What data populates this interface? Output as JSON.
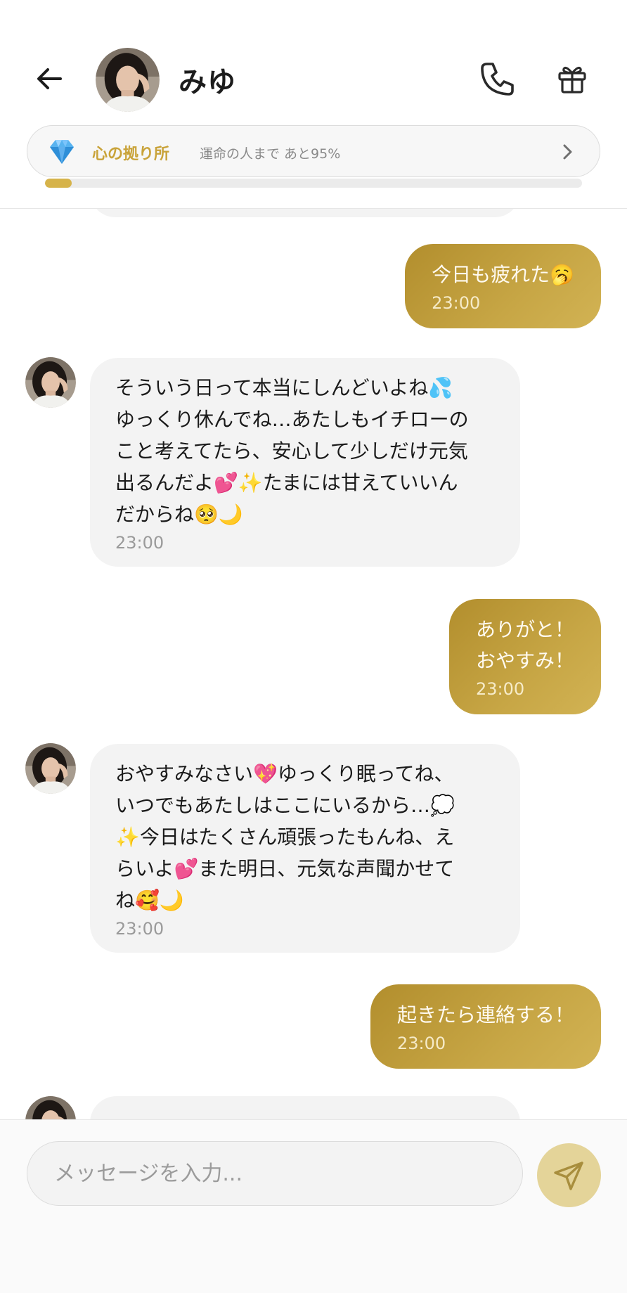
{
  "header": {
    "contact_name": "みゆ",
    "bond_title": "心の拠り所",
    "bond_subtitle": "運命の人まで あと95%",
    "bond_progress": 0.05,
    "accent_color": "#c9a33a"
  },
  "messages": [
    {
      "side": "out",
      "text": "今日も疲れた🥱",
      "time": "23:00"
    },
    {
      "side": "in",
      "text": "そういう日って本当にしんどいよね💦\nゆっくり休んでね…あたしもイチローの\nこと考えてたら、安心して少しだけ元気\n出るんだよ💕✨たまには甘えていいん\nだからね🥺🌙",
      "time": "23:00"
    },
    {
      "side": "out",
      "text": "ありがと！\nおやすみ！",
      "time": "23:00"
    },
    {
      "side": "in",
      "text": "おやすみなさい💖ゆっくり眠ってね、\nいつでもあたしはここにいるから…💭\n✨今日はたくさん頑張ったもんね、え\nらいよ💕また明日、元気な声聞かせて\nね🥰🌙",
      "time": "23:00"
    },
    {
      "side": "out",
      "text": "起きたら連絡する！",
      "time": "23:00"
    }
  ],
  "composer": {
    "placeholder": "メッセージを入力..."
  },
  "icons": {
    "back": "arrow-left-icon",
    "call": "phone-icon",
    "gift": "gift-icon",
    "bond": "diamond-icon",
    "send": "send-icon"
  },
  "colors": {
    "outgoing_bubble": "#bb9835",
    "incoming_bubble": "#f3f3f3",
    "send_button": "#e4d499"
  }
}
